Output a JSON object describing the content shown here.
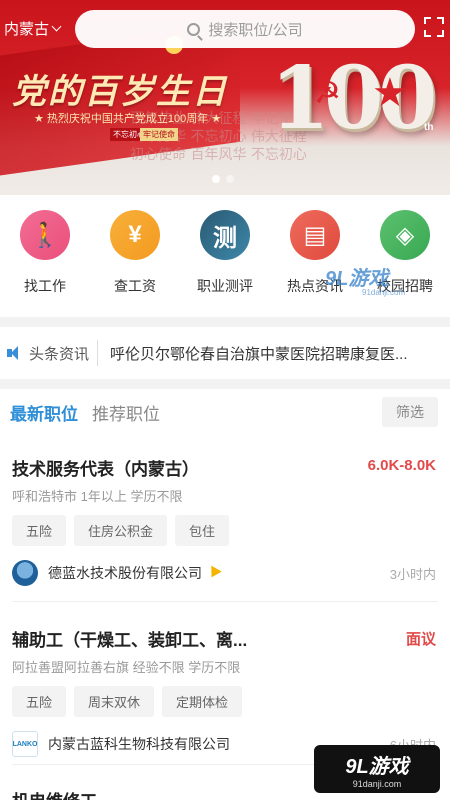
{
  "header": {
    "city": "内蒙古",
    "search_placeholder": "搜索职位/公司"
  },
  "banner": {
    "headline": "党的百岁生日",
    "subline": "★ 热烈庆祝中国共产党成立100周年 ★",
    "mini_a": "不忘初心",
    "mini_b": "牢记使命",
    "big_number": "100",
    "suffix": "th",
    "watermark_lines": [
      "百年伟业  伟大征程  牢记使命",
      "百年芳华  不忘初心  伟大征程",
      "初心使命  百年风华  不忘初心"
    ],
    "slide_count": 2,
    "active_slide": 1
  },
  "categories": [
    {
      "label": "找工作",
      "icon": "walking-person-icon",
      "glyph": "🚶"
    },
    {
      "label": "查工资",
      "icon": "yuan-coin-icon",
      "glyph": "¥"
    },
    {
      "label": "职业测评",
      "icon": "assessment-icon",
      "glyph": "测"
    },
    {
      "label": "热点资讯",
      "icon": "clapperboard-icon",
      "glyph": "▤"
    },
    {
      "label": "校园招聘",
      "icon": "wifi-book-icon",
      "glyph": "◈"
    }
  ],
  "news": {
    "tag": "头条资讯",
    "headline": "呼伦贝尔鄂伦春自治旗中蒙医院招聘康复医..."
  },
  "jobs_section": {
    "tabs": [
      "最新职位",
      "推荐职位"
    ],
    "active_tab": 0,
    "filter_label": "筛选"
  },
  "jobs": [
    {
      "title": "技术服务代表（内蒙古）",
      "salary": "6.0K-8.0K",
      "meta": "呼和浩特市  1年以上  学历不限",
      "tags": [
        "五险",
        "住房公积金",
        "包住"
      ],
      "company": "德蓝水技术股份有限公司",
      "time": "3小时内"
    },
    {
      "title": "辅助工（干燥工、装卸工、离...",
      "salary": "面议",
      "meta": "阿拉善盟阿拉善右旗  经验不限  学历不限",
      "tags": [
        "五险",
        "周末双休",
        "定期体检"
      ],
      "company": "内蒙古蓝科生物科技有限公司",
      "time": "6小时内",
      "logo_text": "LANKO"
    },
    {
      "title": "机电维修工"
    }
  ],
  "watermark": {
    "main": "9L游戏",
    "site": "91danji.com"
  },
  "colors": {
    "accent": "#2f8fd8",
    "salary": "#e24a4a",
    "banner_red": "#d8232a"
  }
}
